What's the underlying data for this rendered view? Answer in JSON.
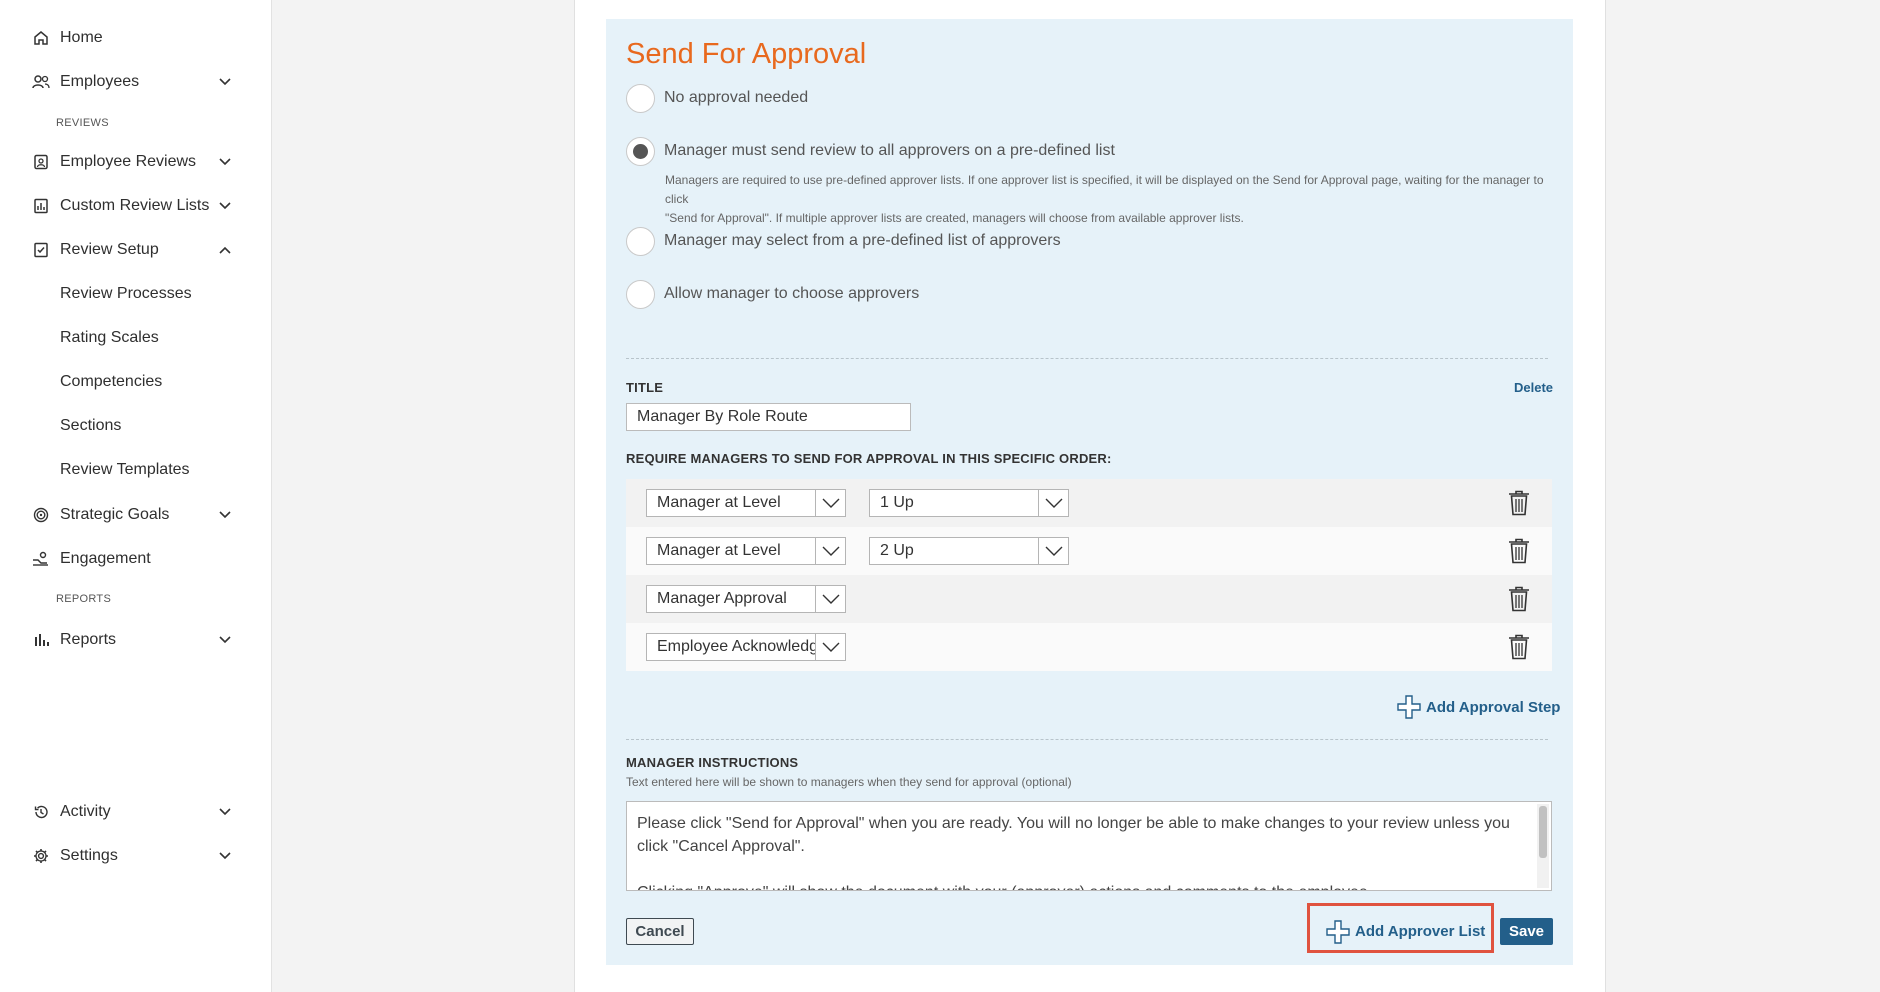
{
  "sidebar": {
    "items": [
      {
        "label": "Home",
        "icon": "home-icon"
      },
      {
        "label": "Employees",
        "icon": "users-icon"
      },
      {
        "label": "Employee Reviews",
        "icon": "badge-icon"
      },
      {
        "label": "Custom Review Lists",
        "icon": "chart-icon"
      },
      {
        "label": "Review Setup",
        "icon": "checklist-icon"
      },
      {
        "label": "Strategic Goals",
        "icon": "target-icon"
      },
      {
        "label": "Engagement",
        "icon": "engagement-icon"
      },
      {
        "label": "Reports",
        "icon": "bar-chart-icon"
      },
      {
        "label": "Activity",
        "icon": "history-icon"
      },
      {
        "label": "Settings",
        "icon": "gear-icon"
      }
    ],
    "headings": {
      "reviews": "REVIEWS",
      "reports": "REPORTS"
    },
    "review_setup_children": [
      "Review Processes",
      "Rating Scales",
      "Competencies",
      "Sections",
      "Review Templates"
    ]
  },
  "approval": {
    "title": "Send For Approval",
    "options": [
      {
        "label": "No approval needed",
        "selected": false
      },
      {
        "label": "Manager must send review to all approvers on a pre-defined list",
        "selected": true
      },
      {
        "label": "Manager may select from a pre-defined list of approvers",
        "selected": false
      },
      {
        "label": "Allow manager to choose approvers",
        "selected": false
      }
    ],
    "option_help": {
      "line1": "Managers are required to use pre-defined approver lists. If one approver list is specified, it will be displayed on the Send for Approval page, waiting for the manager to click",
      "line2": "\"Send for Approval\". If multiple approver lists are created, managers will choose from available approver lists."
    },
    "title_label": "TITLE",
    "delete_label": "Delete",
    "title_value": "Manager By Role Route",
    "order_label": "REQUIRE MANAGERS TO SEND FOR APPROVAL IN THIS SPECIFIC ORDER:",
    "steps": [
      {
        "type": "Manager at Level",
        "level": "1 Up"
      },
      {
        "type": "Manager at Level",
        "level": "2 Up"
      },
      {
        "type": "Manager Approval",
        "level": ""
      },
      {
        "type": "Employee Acknowledgement",
        "level": ""
      }
    ],
    "add_step_label": "Add Approval Step",
    "instructions_label": "MANAGER INSTRUCTIONS",
    "instructions_help": "Text entered here will be shown to managers when they send for approval (optional)",
    "instructions_text": "Please click \"Send for Approval\" when you are ready. You will no longer be able to make changes to your review unless you click \"Cancel Approval\".",
    "instructions_text2": "Clicking \"Approve\" will show the document with your (approver) actions and comments to the employee.",
    "cancel_label": "Cancel",
    "add_list_label": "Add Approver List",
    "save_label": "Save",
    "accent_color": "#e8691e",
    "button_color": "#235f8a",
    "highlight_color": "#e0533f"
  }
}
